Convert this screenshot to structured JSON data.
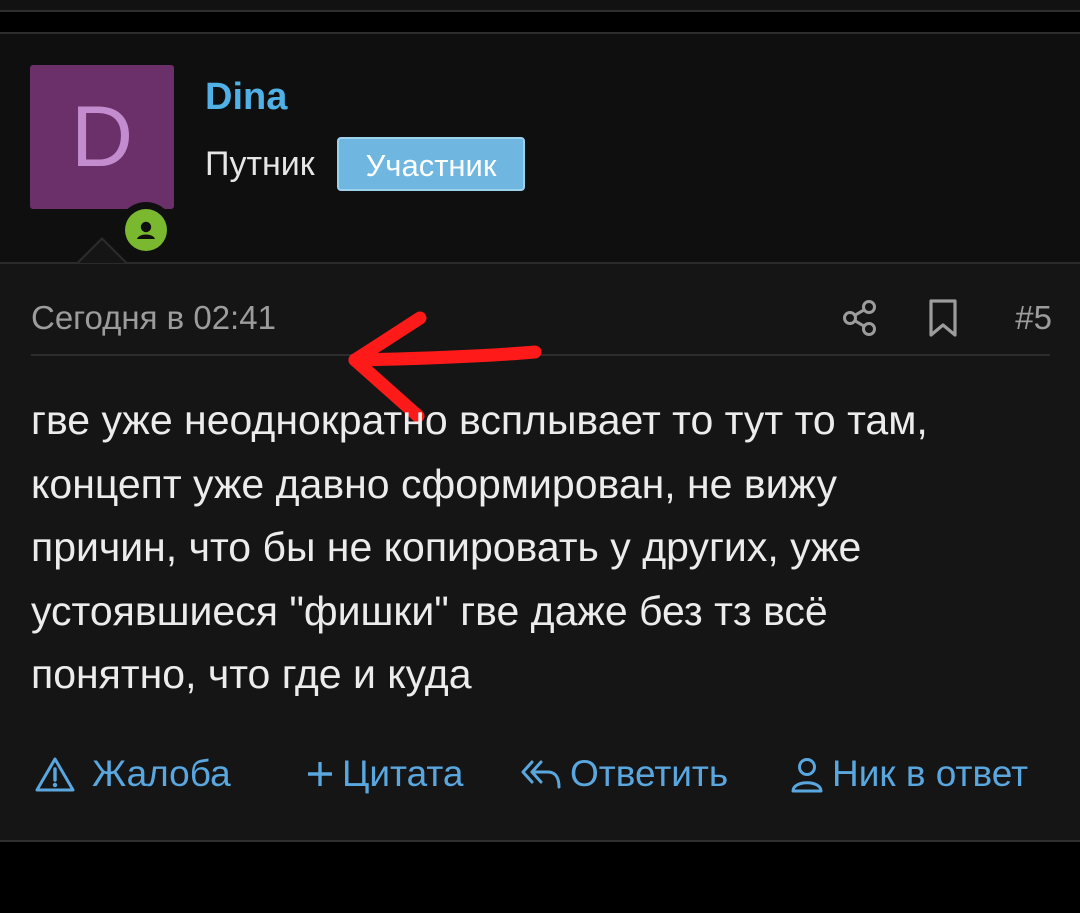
{
  "post": {
    "author": {
      "avatar_letter": "D",
      "username": "Dina",
      "title": "Путник",
      "badge": "Участник",
      "avatar_color": "#6b3069",
      "online_color": "#7ab82f"
    },
    "meta": {
      "date": "Сегодня в 02:41",
      "share_icon": "share-icon",
      "bookmark_icon": "bookmark-icon",
      "number": "#5"
    },
    "body_lines": [
      "гве уже неоднократно всплывает то тут то там,",
      "концепт уже давно сформирован, не вижу",
      "причин, что бы не копировать у других, уже",
      "устоявшиеся \"фишки\" гве даже без тз всё",
      "понятно, что где и куда"
    ],
    "actions": {
      "report": "Жалоба",
      "quote": "Цитата",
      "reply": "Ответить",
      "mention": "Ник в ответ"
    },
    "link_color": "#5aa7df"
  },
  "annotation": {
    "arrow_color": "#ff1a1a"
  }
}
